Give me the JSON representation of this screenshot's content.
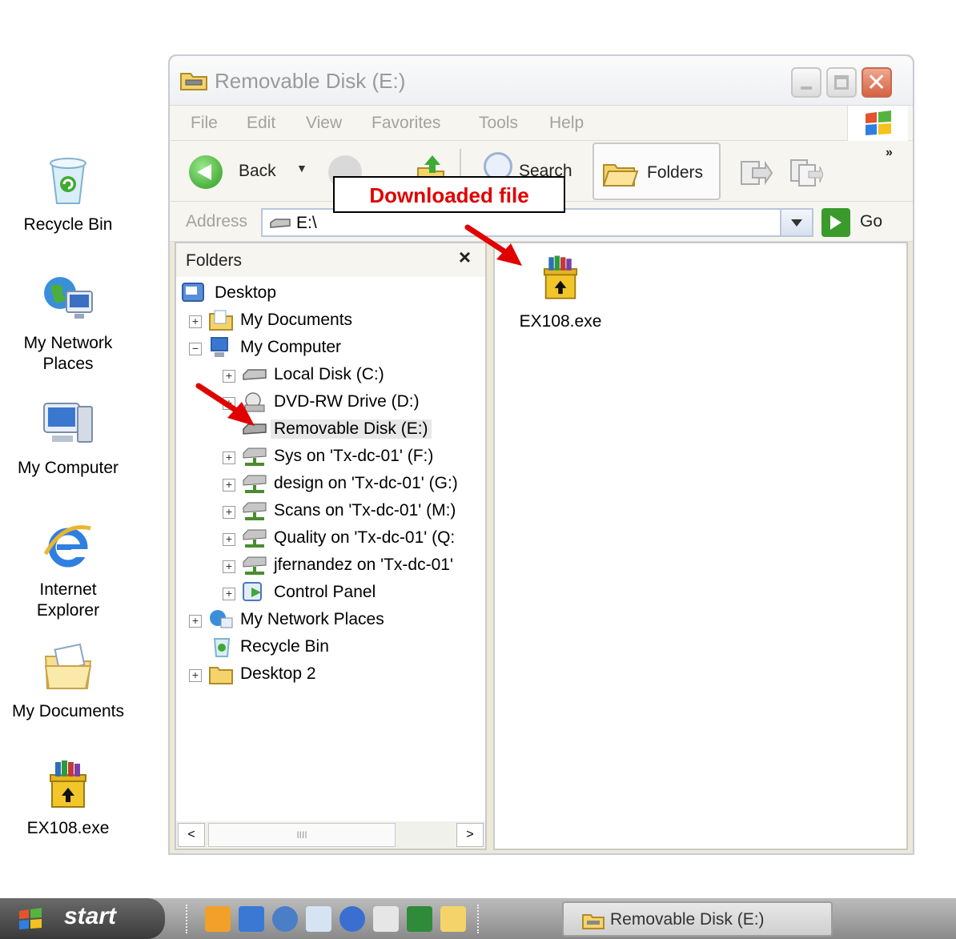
{
  "desktop": {
    "icons": [
      {
        "label": "Recycle Bin",
        "icon": "recycle-bin-icon"
      },
      {
        "label": "My Network Places",
        "line1": "My Network",
        "line2": "Places",
        "icon": "network-places-icon"
      },
      {
        "label": "My Computer",
        "icon": "my-computer-icon"
      },
      {
        "label": "Internet Explorer",
        "line1": "Internet",
        "line2": "Explorer",
        "icon": "internet-explorer-icon"
      },
      {
        "label": "My Documents",
        "icon": "my-documents-icon"
      },
      {
        "label": "EX108.exe",
        "icon": "winrar-archive-icon"
      }
    ]
  },
  "window": {
    "title": "Removable Disk (E:)",
    "menu": [
      "File",
      "Edit",
      "View",
      "Favorites",
      "Tools",
      "Help"
    ],
    "toolbar": {
      "back_label": "Back",
      "search_label": "Search",
      "folders_label": "Folders",
      "more": "»"
    },
    "address": {
      "label": "Address",
      "value": "E:\\",
      "go_label": "Go"
    },
    "folders_pane": {
      "title": "Folders",
      "close": "×",
      "tree": [
        {
          "label": "Desktop",
          "level": 0,
          "expander": ""
        },
        {
          "label": "My Documents",
          "level": 1,
          "expander": "+"
        },
        {
          "label": "My Computer",
          "level": 1,
          "expander": "−"
        },
        {
          "label": "Local Disk (C:)",
          "level": 2,
          "expander": "+"
        },
        {
          "label": "DVD-RW Drive (D:)",
          "level": 2,
          "expander": "+"
        },
        {
          "label": "Removable Disk (E:)",
          "level": 2,
          "expander": "",
          "selected": true
        },
        {
          "label": "Sys on 'Tx-dc-01' (F:)",
          "level": 2,
          "expander": "+"
        },
        {
          "label": "design on 'Tx-dc-01' (G:)",
          "level": 2,
          "expander": "+"
        },
        {
          "label": "Scans on 'Tx-dc-01' (M:)",
          "level": 2,
          "expander": "+"
        },
        {
          "label": "Quality on 'Tx-dc-01' (Q:",
          "level": 2,
          "expander": "+"
        },
        {
          "label": "jfernandez on 'Tx-dc-01'",
          "level": 2,
          "expander": "+"
        },
        {
          "label": "Control Panel",
          "level": 2,
          "expander": "+"
        },
        {
          "label": "My Network Places",
          "level": 1,
          "expander": "+"
        },
        {
          "label": "Recycle Bin",
          "level": 1,
          "expander": ""
        },
        {
          "label": "Desktop 2",
          "level": 1,
          "expander": "+"
        }
      ],
      "scroll_left": "<",
      "scroll_right": ">",
      "thumb_grip": "IIII"
    },
    "content": {
      "files": [
        {
          "name": "EX108.exe",
          "icon": "winrar-archive-icon"
        }
      ]
    }
  },
  "callout": {
    "text": "Downloaded file",
    "color": "#e00000"
  },
  "taskbar": {
    "start_label": "start",
    "task_label": "Removable Disk (E:)"
  }
}
